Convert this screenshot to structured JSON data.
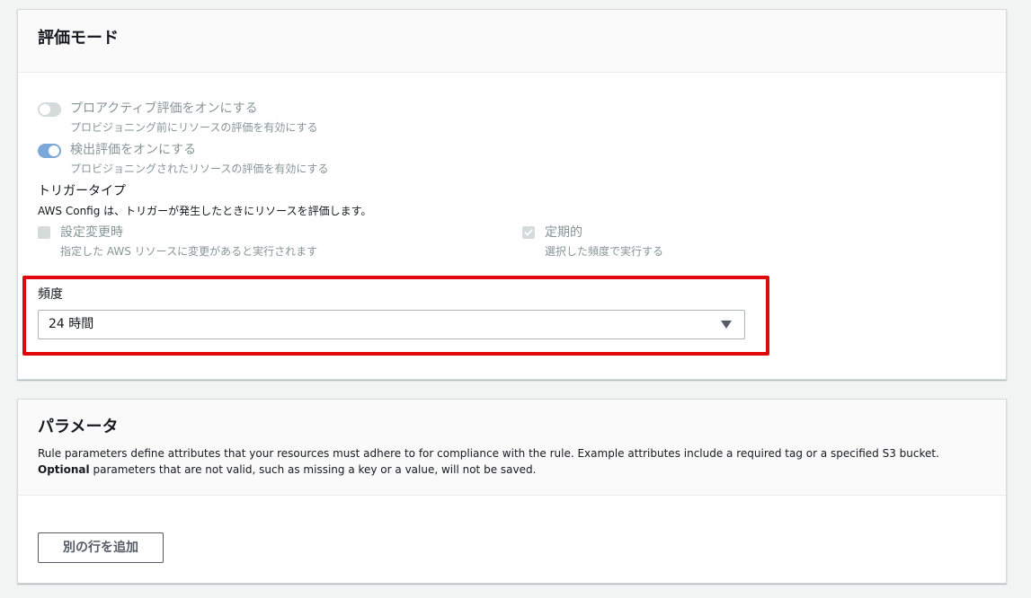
{
  "evaluation_mode": {
    "title": "評価モード",
    "proactive": {
      "label": "プロアクティブ評価をオンにする",
      "description": "プロビジョニング前にリソースの評価を有効にする",
      "enabled": false,
      "disabled": true
    },
    "detective": {
      "label": "検出評価をオンにする",
      "description": "プロビジョニングされたリソースの評価を有効にする",
      "enabled": true,
      "disabled": true
    },
    "trigger_type": {
      "label": "トリガータイプ",
      "description": "AWS Config は、トリガーが発生したときにリソースを評価します。",
      "options": [
        {
          "label": "設定変更時",
          "description": "指定した AWS リソースに変更があると実行されます",
          "checked": false,
          "disabled": true
        },
        {
          "label": "定期的",
          "description": "選択した頻度で実行する",
          "checked": true,
          "disabled": true
        }
      ]
    },
    "frequency": {
      "label": "頻度",
      "value": "24 時間"
    }
  },
  "parameters": {
    "title": "パラメータ",
    "description": "Rule parameters define attributes that your resources must adhere to for compliance with the rule. Example attributes include a required tag or a specified S3 bucket.",
    "description_bold": "Optional",
    "description_tail": "parameters that are not valid, such as missing a key or a value, will not be saved.",
    "add_row_button": "別の行を追加"
  },
  "colors": {
    "highlight_border": "#e0080b",
    "toggle_on": "#7aa9d8",
    "toggle_off": "#d5dbdb",
    "disabled_text": "#879596",
    "page_background": "#f2f3f3"
  }
}
